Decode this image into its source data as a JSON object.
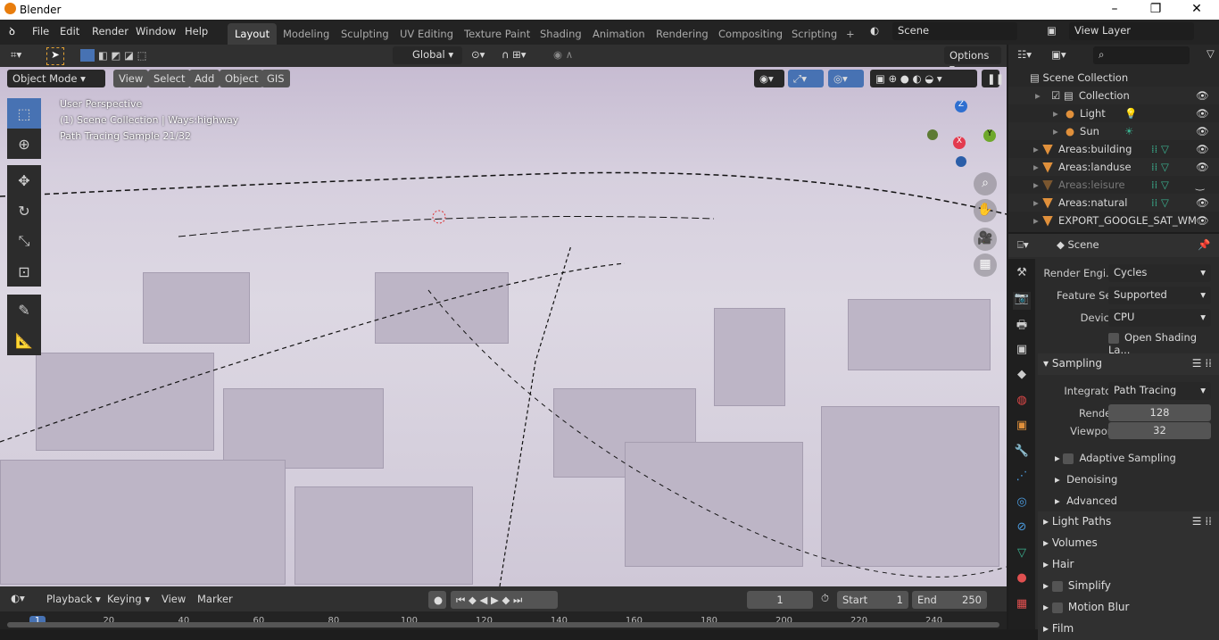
{
  "title": "Blender",
  "menu": [
    "File",
    "Edit",
    "Render",
    "Window",
    "Help"
  ],
  "workspaces": [
    "Layout",
    "Modeling",
    "Sculpting",
    "UV Editing",
    "Texture Paint",
    "Shading",
    "Animation",
    "Rendering",
    "Compositing",
    "Scripting"
  ],
  "scene": "Scene",
  "view_layer": "View Layer",
  "header": {
    "transform": "Global",
    "options": "Options",
    "mode": "Object Mode",
    "menus": [
      "View",
      "Select",
      "Add",
      "Object",
      "GIS"
    ]
  },
  "viewport": {
    "line1": "User Perspective",
    "line2": "(1) Scene Collection | Ways:highway",
    "line3": "Path Tracing Sample 21/32",
    "gizmo": {
      "z": "Z",
      "y": "Y",
      "x": "X"
    }
  },
  "outliner": {
    "root": "Scene Collection",
    "items": [
      {
        "name": "Collection",
        "visible": true
      },
      {
        "name": "Light",
        "visible": true
      },
      {
        "name": "Sun",
        "visible": true
      },
      {
        "name": "Areas:building",
        "visible": true
      },
      {
        "name": "Areas:landuse",
        "visible": true
      },
      {
        "name": "Areas:leisure",
        "visible": false
      },
      {
        "name": "Areas:natural",
        "visible": true
      },
      {
        "name": "EXPORT_GOOGLE_SAT_WM",
        "visible": true
      }
    ]
  },
  "properties": {
    "context": "Scene",
    "render_engine_label": "Render Engi...",
    "render_engine": "Cycles",
    "feature_set_label": "Feature Set",
    "feature_set": "Supported",
    "device_label": "Device",
    "device": "CPU",
    "open_shading": "Open Shading La...",
    "sampling": "Sampling",
    "integrator_label": "Integrator",
    "integrator": "Path Tracing",
    "render_label": "Render",
    "render": "128",
    "viewport_label": "Viewport",
    "viewport": "32",
    "subsections": [
      "Adaptive Sampling",
      "Denoising",
      "Advanced"
    ],
    "sections": [
      "Light Paths",
      "Volumes",
      "Hair",
      "Simplify",
      "Motion Blur",
      "Film"
    ]
  },
  "timeline": {
    "menus": [
      "Playback",
      "Keying",
      "View",
      "Marker"
    ],
    "current_frame": "1",
    "start_label": "Start",
    "start": "1",
    "end_label": "End",
    "end": "250",
    "ticks": [
      "1",
      "20",
      "40",
      "60",
      "80",
      "100",
      "120",
      "140",
      "160",
      "180",
      "200",
      "220",
      "240"
    ]
  }
}
